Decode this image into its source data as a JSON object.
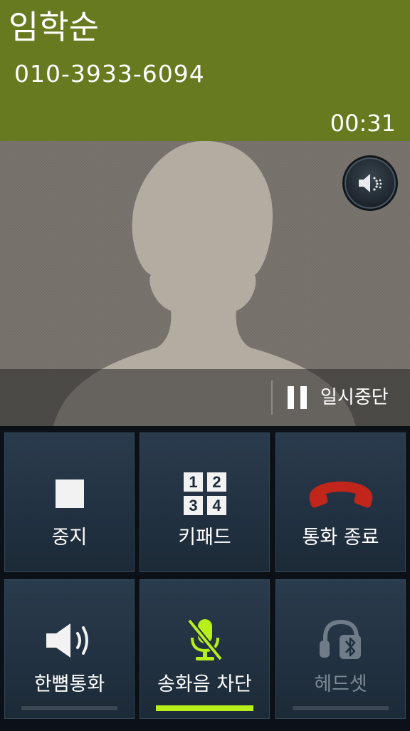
{
  "call": {
    "caller_name": "임학순",
    "phone_number": "010-3933-6094",
    "duration": "00:31"
  },
  "photo": {
    "avatar_icon": "person-silhouette-icon"
  },
  "speaker_float": {
    "icon": "speaker-sound-icon"
  },
  "hold": {
    "icon": "pause-icon",
    "label": "일시중단"
  },
  "buttons": [
    {
      "label": "중지",
      "icon": "stop-square-icon",
      "enabled": true
    },
    {
      "label": "키패드",
      "icon": "keypad-icon",
      "enabled": true,
      "keys": [
        "1",
        "2",
        "3",
        "4"
      ]
    },
    {
      "label": "통화 종료",
      "icon": "end-call-handset-icon",
      "enabled": true,
      "accent": "#c2261b"
    },
    {
      "label": "한뼘통화",
      "icon": "speaker-icon",
      "enabled": true,
      "toggle_on": false
    },
    {
      "label": "송화음 차단",
      "icon": "mic-muted-icon",
      "enabled": true,
      "toggle_on": true,
      "accent": "#b6ef1a"
    },
    {
      "label": "헤드셋",
      "icon": "bluetooth-headset-icon",
      "enabled": false,
      "toggle_on": false
    }
  ],
  "colors": {
    "header_bg": "#677a1f",
    "tile_bg": "#223244",
    "active_indicator": "#b6ef1a",
    "end_call_red": "#c2261b"
  }
}
